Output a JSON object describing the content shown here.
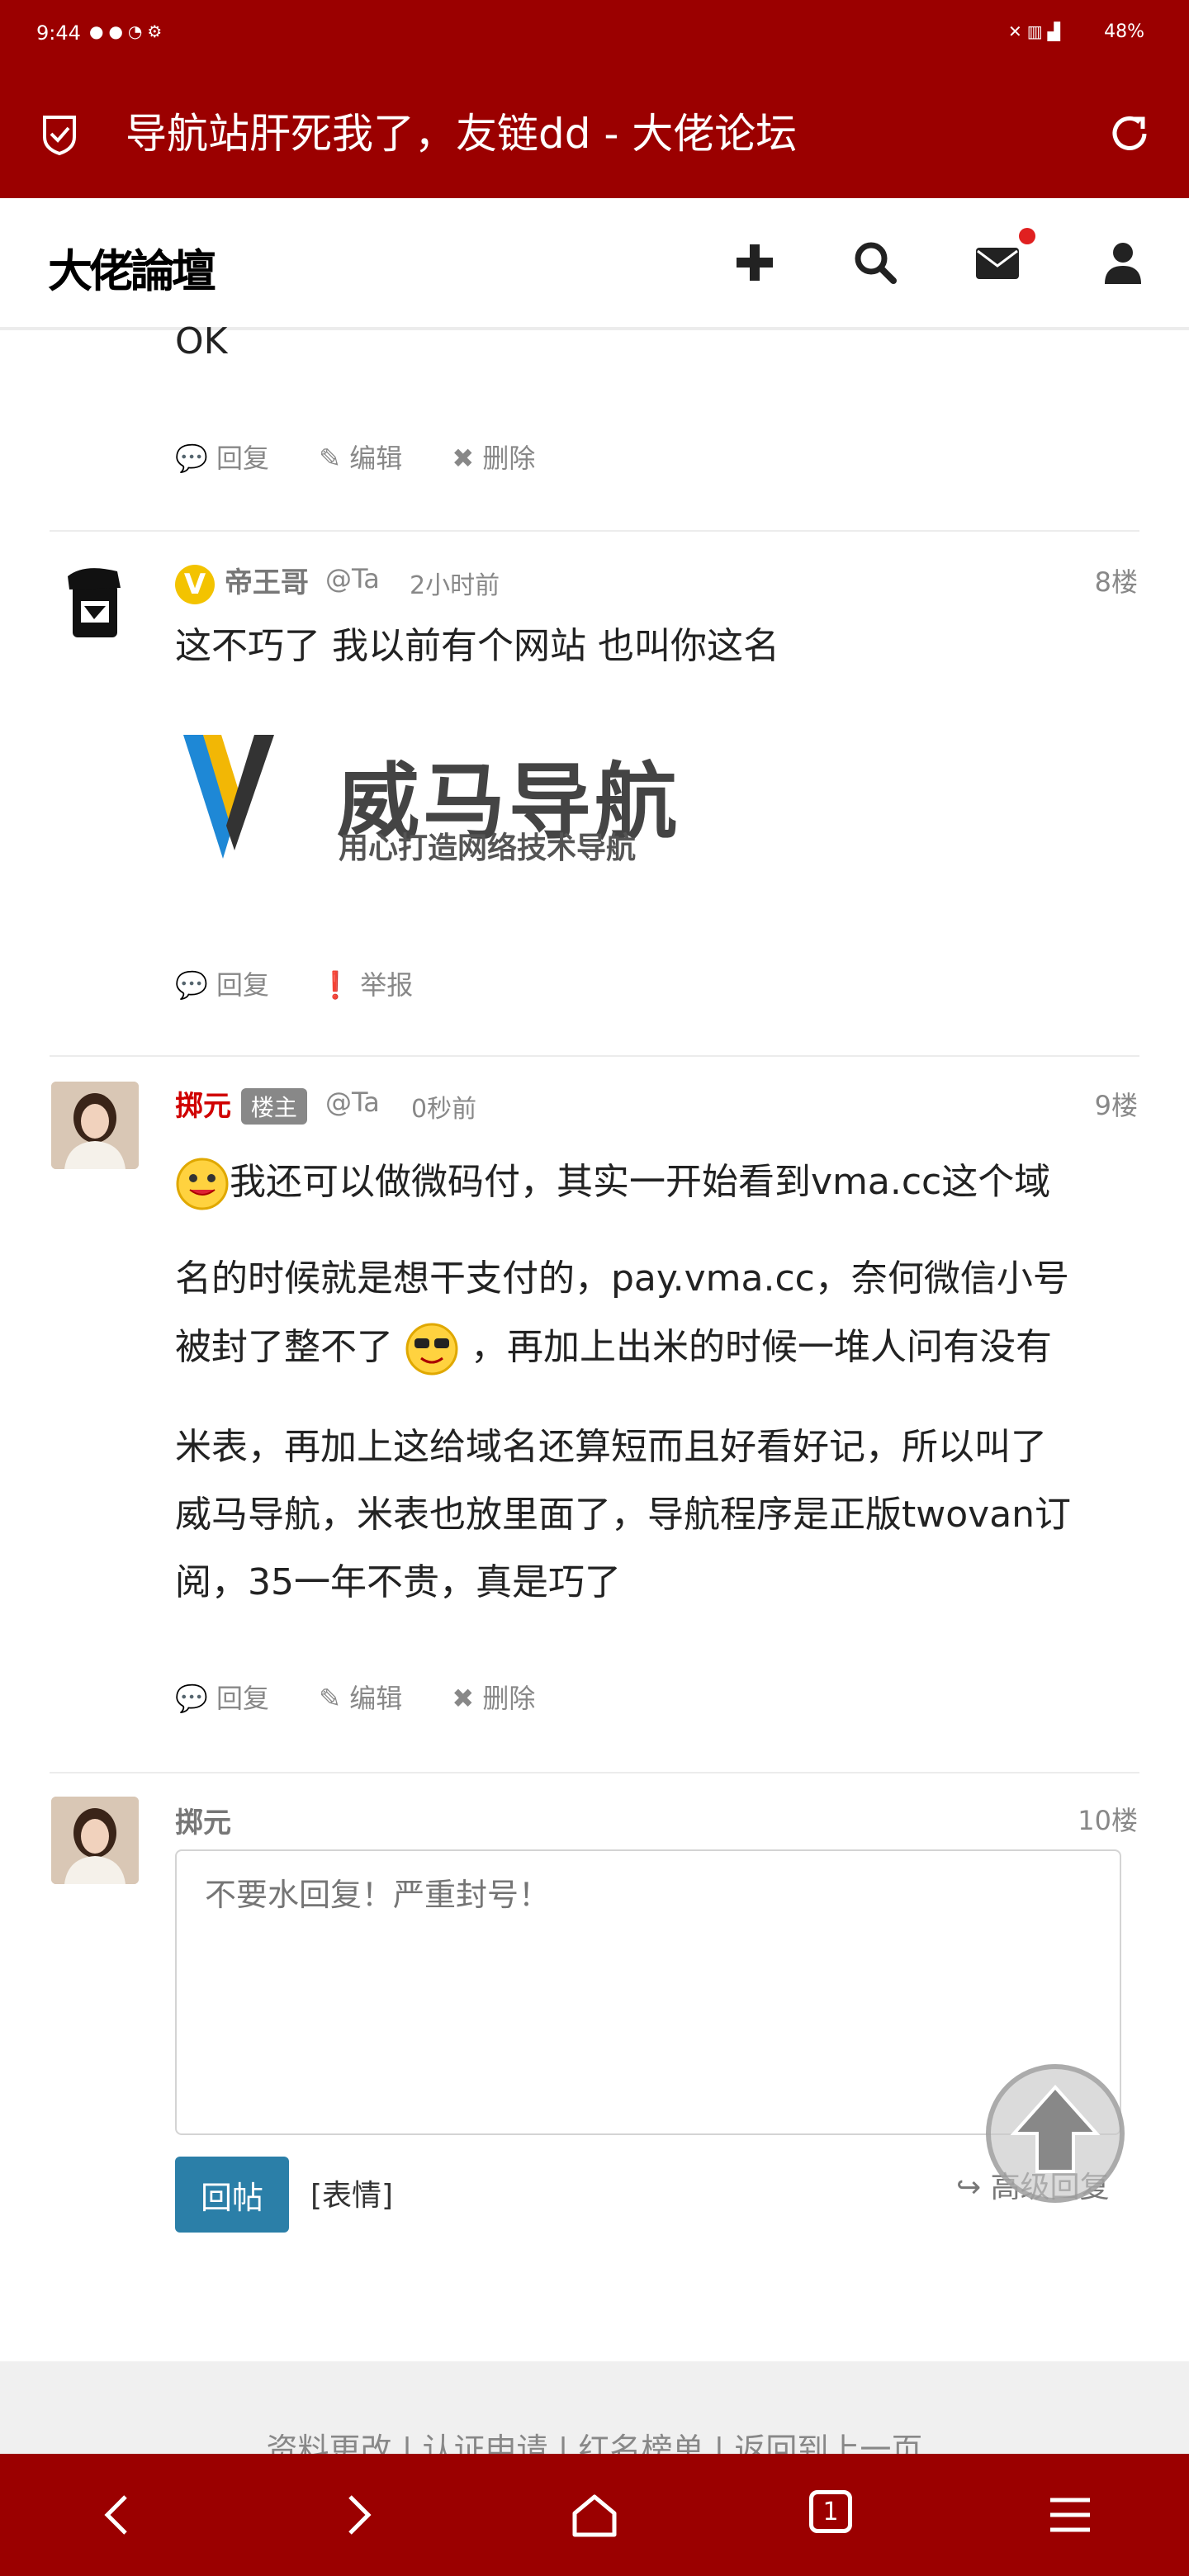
{
  "status_bar": {
    "time": "9:44",
    "battery": "48%"
  },
  "browser": {
    "page_title": "导航站肝死我了，友链dd - 大佬论坛",
    "tab_count": "1"
  },
  "site": {
    "logo_text": "大佬論壇"
  },
  "posts": [
    {
      "text": "OK",
      "actions": [
        "回复",
        "编辑",
        "删除"
      ]
    },
    {
      "author": "帝王哥",
      "at": "@Ta",
      "time": "2小时前",
      "floor": "8楼",
      "text": "这不巧了 我以前有个网站 也叫你这名",
      "image_logo": {
        "title": "威马导航",
        "slogan": "用心打造网络技术导航"
      },
      "actions": [
        "回复",
        "举报"
      ]
    },
    {
      "author": "掷元",
      "badge": "楼主",
      "at": "@Ta",
      "time": "0秒前",
      "floor": "9楼",
      "lines": [
        "我还可以做微码付，其实一开始看到vma.cc这个域",
        "名的时候就是想干支付的，pay.vma.cc，奈何微信小号",
        "被封了整不了",
        "，再加上出米的时候一堆人问有没有",
        "米表，再加上这给域名还算短而且好看好记，所以叫了",
        "威马导航，米表也放里面了，导航程序是正版twovan订",
        "阅，35一年不贵，真是巧了"
      ],
      "actions": [
        "回复",
        "编辑",
        "删除"
      ]
    }
  ],
  "reply": {
    "author": "掷元",
    "floor": "10楼",
    "placeholder": "不要水回复！严重封号！",
    "submit_label": "回帖",
    "emote_label": "[表情]",
    "advanced_label": "高级回复"
  },
  "footer": {
    "links": "资料更改 | 认证申请 | 红名榜单 | 返回到上一页"
  },
  "colors": {
    "brand": "#9b0000",
    "button": "#2b7fa8",
    "notify_dot": "#e02020"
  }
}
